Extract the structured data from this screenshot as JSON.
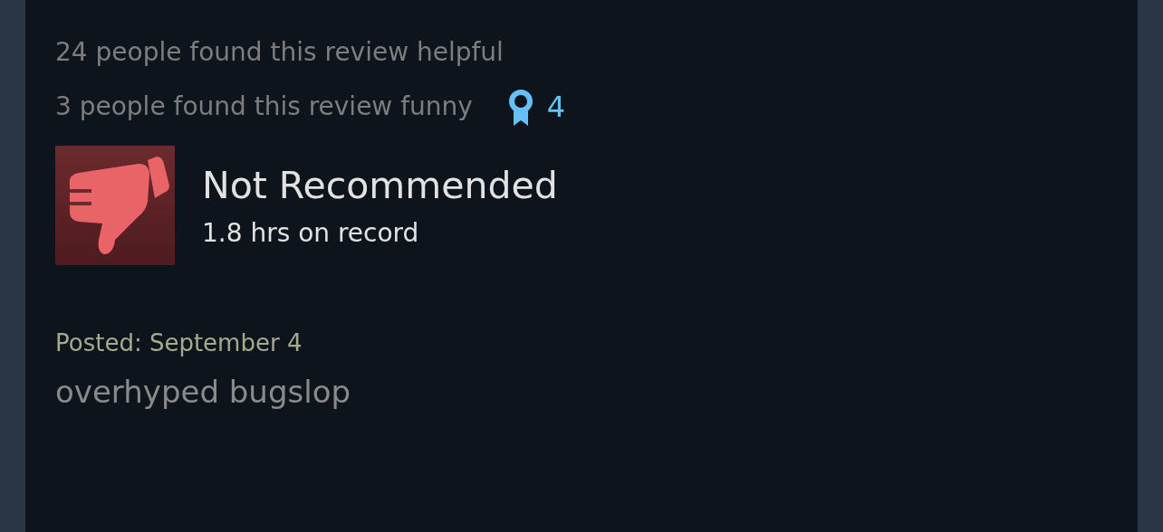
{
  "votes": {
    "helpful": "24 people found this review helpful",
    "funny": "3 people found this review funny",
    "awards": "4"
  },
  "recommendation": {
    "recommended": false,
    "label": "Not Recommended",
    "hours": "1.8 hrs on record"
  },
  "posted": "Posted: September 4",
  "body": "overhyped bugslop"
}
